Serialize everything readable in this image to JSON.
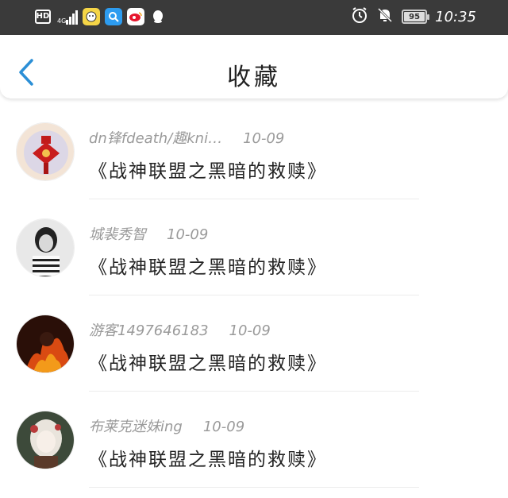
{
  "status_bar": {
    "hd_label": "HD",
    "network": "4G",
    "battery_level": "95",
    "time": "10:35",
    "icons": [
      "hd-icon",
      "signal-icon",
      "app-icon-1",
      "search-app-icon",
      "weibo-icon",
      "qq-icon",
      "alarm-icon",
      "mute-bell-icon",
      "battery-icon"
    ]
  },
  "nav": {
    "title": "收藏",
    "back_icon": "chevron-left-icon"
  },
  "items": [
    {
      "user": "dn锋fdeath/趣kni…",
      "date": "10-09",
      "title": "《战神联盟之黑暗的救赎》"
    },
    {
      "user": "城裴秀智",
      "date": "10-09",
      "title": "《战神联盟之黑暗的救赎》"
    },
    {
      "user": "游客1497646183",
      "date": "10-09",
      "title": "《战神联盟之黑暗的救赎》"
    },
    {
      "user": "布莱克迷妹ing",
      "date": "10-09",
      "title": "《战神联盟之黑暗的救赎》"
    }
  ],
  "colors": {
    "status_bar_bg": "#3a3a3a",
    "accent": "#2b8fd6",
    "meta_text": "#9a9a9a"
  }
}
